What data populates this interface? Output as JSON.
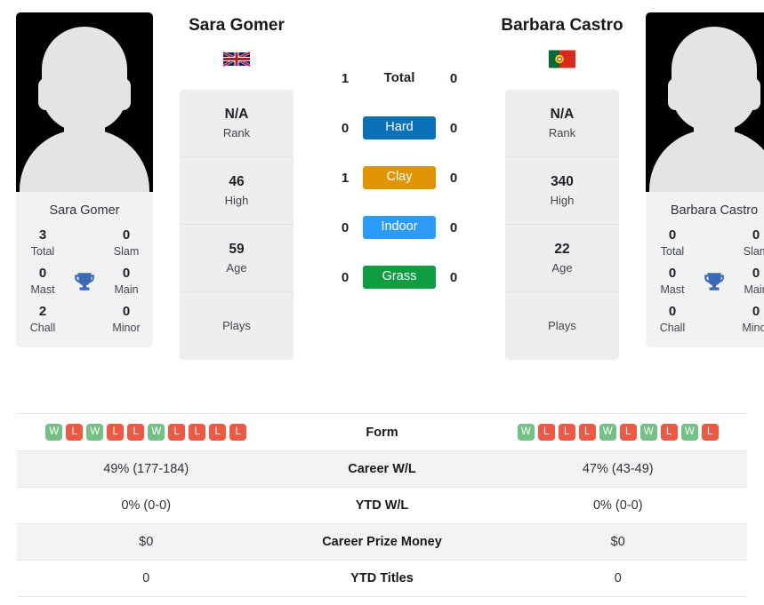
{
  "players": [
    {
      "name": "Sara Gomer",
      "card_name": "Sara Gomer",
      "flag": "gb-flag-icon",
      "rank": "N/A",
      "rank_label": "Rank",
      "high": "46",
      "high_label": "High",
      "age": "59",
      "age_label": "Age",
      "plays": "",
      "plays_label": "Plays",
      "titles": {
        "total": "3",
        "total_label": "Total",
        "slam": "0",
        "slam_label": "Slam",
        "mast": "0",
        "mast_label": "Mast",
        "main": "0",
        "main_label": "Main",
        "chall": "2",
        "chall_label": "Chall",
        "minor": "0",
        "minor_label": "Minor"
      },
      "form": [
        "W",
        "L",
        "W",
        "L",
        "L",
        "W",
        "L",
        "L",
        "L",
        "L"
      ],
      "career_wl": "49% (177-184)",
      "ytd_wl": "0% (0-0)",
      "career_prize_money": "$0",
      "ytd_titles": "0"
    },
    {
      "name": "Barbara Castro",
      "card_name": "Barbara Castro",
      "flag": "pt-flag-icon",
      "rank": "N/A",
      "rank_label": "Rank",
      "high": "340",
      "high_label": "High",
      "age": "22",
      "age_label": "Age",
      "plays": "",
      "plays_label": "Plays",
      "titles": {
        "total": "0",
        "total_label": "Total",
        "slam": "0",
        "slam_label": "Slam",
        "mast": "0",
        "mast_label": "Mast",
        "main": "0",
        "main_label": "Main",
        "chall": "0",
        "chall_label": "Chall",
        "minor": "0",
        "minor_label": "Minor"
      },
      "form": [
        "W",
        "L",
        "L",
        "L",
        "W",
        "L",
        "W",
        "L",
        "W",
        "L"
      ],
      "career_wl": "47% (43-49)",
      "ytd_wl": "0% (0-0)",
      "career_prize_money": "$0",
      "ytd_titles": "0"
    }
  ],
  "h2h": {
    "total": {
      "label": "Total",
      "left": "1",
      "right": "0"
    },
    "surfaces": [
      {
        "label": "Hard",
        "left": "0",
        "right": "0",
        "color": "#0b72ba"
      },
      {
        "label": "Clay",
        "left": "1",
        "right": "0",
        "color": "#e19404"
      },
      {
        "label": "Indoor",
        "left": "0",
        "right": "0",
        "color": "#2b9cfb"
      },
      {
        "label": "Grass",
        "left": "0",
        "right": "0",
        "color": "#0f9d42"
      }
    ]
  },
  "comparison_rows": [
    {
      "label": "Form",
      "left": "",
      "right": ""
    },
    {
      "label": "Career W/L",
      "left": "49% (177-184)",
      "right": "47% (43-49)"
    },
    {
      "label": "YTD W/L",
      "left": "0% (0-0)",
      "right": "0% (0-0)"
    },
    {
      "label": "Career Prize Money",
      "left": "$0",
      "right": "$0"
    },
    {
      "label": "YTD Titles",
      "left": "0",
      "right": "0"
    }
  ],
  "colors": {
    "win": "#74c186",
    "loss": "#ef5843",
    "trophy": "#3a6ab5",
    "card_bg": "#eeeeef"
  }
}
